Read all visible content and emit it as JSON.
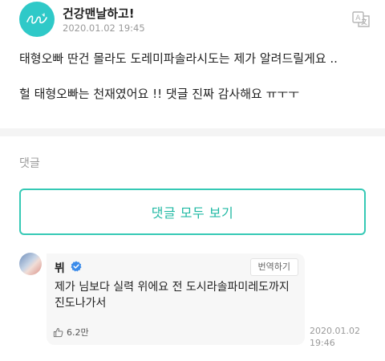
{
  "post": {
    "author": "건강맨날하고!",
    "time": "2020.01.02 19:45",
    "lines": [
      "태형오빠 딴건 몰라도 도레미파솔라시도는 제가 알려드릴게요 ..",
      "헐 태형오빠는 천재였어요 !! 댓글 진짜 감사해요 ㅠㅜㅜ"
    ]
  },
  "comments_section": {
    "label": "댓글",
    "view_all_label": "댓글 모두 보기"
  },
  "comment": {
    "author": "뷔",
    "translate_label": "번역하기",
    "text": "제가 님보다 실력 위에요 전 도시라솔파미레도까지 진도나가서",
    "likes": "6.2만",
    "date": "2020.01.02",
    "time": "19:46"
  },
  "colors": {
    "accent": "#35c9b5",
    "avatar": "#2fc9c8",
    "verified": "#3b8bea"
  }
}
